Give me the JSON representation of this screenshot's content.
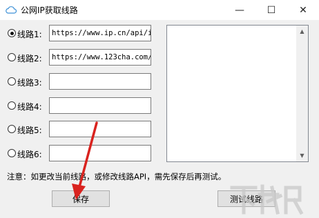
{
  "window": {
    "title": "公网IP获取线路",
    "icon": "cloud-icon",
    "controls": {
      "minimize": "—",
      "maximize": "☐",
      "close": "✕"
    }
  },
  "routes": [
    {
      "label": "线路1:",
      "value": "https://www.ip.cn/api/index",
      "selected": true
    },
    {
      "label": "线路2:",
      "value": "https://www.123cha.com/",
      "selected": false
    },
    {
      "label": "线路3:",
      "value": "",
      "selected": false
    },
    {
      "label": "线路4:",
      "value": "",
      "selected": false
    },
    {
      "label": "线路5:",
      "value": "",
      "selected": false
    },
    {
      "label": "线路6:",
      "value": "",
      "selected": false
    }
  ],
  "note": "注意：如更改当前线路，或修改线路API，需先保存后再测试。",
  "buttons": {
    "save": "保存",
    "test": "测试线路"
  },
  "colors": {
    "arrow": "#d9231f",
    "window_bg": "#f0f0f0",
    "title_bg": "#ffffff"
  }
}
